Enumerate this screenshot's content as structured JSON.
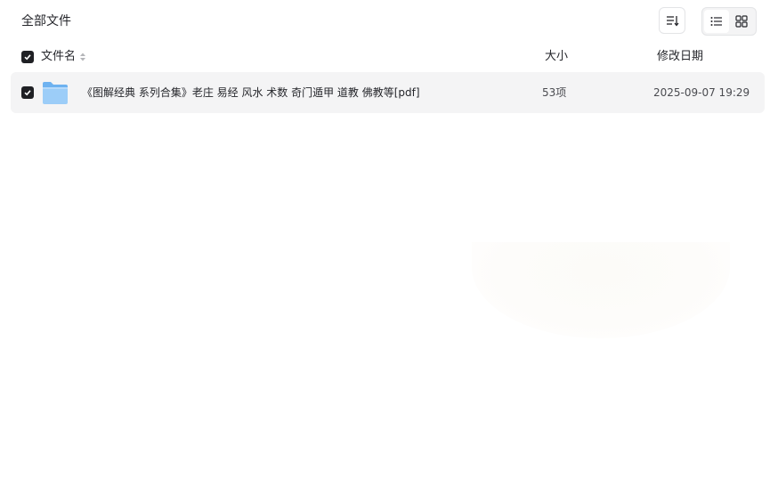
{
  "breadcrumb": "全部文件",
  "toolbar": {
    "sort_icon": "sort-icon",
    "view_list_icon": "list-view-icon",
    "view_grid_icon": "grid-view-icon"
  },
  "columns": {
    "name": "文件名",
    "size": "大小",
    "date": "修改日期"
  },
  "files": [
    {
      "name": "《图解经典 系列合集》老庄 易经 风水 术数 奇门遁甲 道教 佛教等[pdf]",
      "size": "53项",
      "modified": "2025-09-07 19:29",
      "icon": "folder-icon",
      "checked": true
    }
  ],
  "colors": {
    "checkbox": "#1f2024",
    "row_bg": "#f4f4f5",
    "folder": "#8cc5f7"
  }
}
